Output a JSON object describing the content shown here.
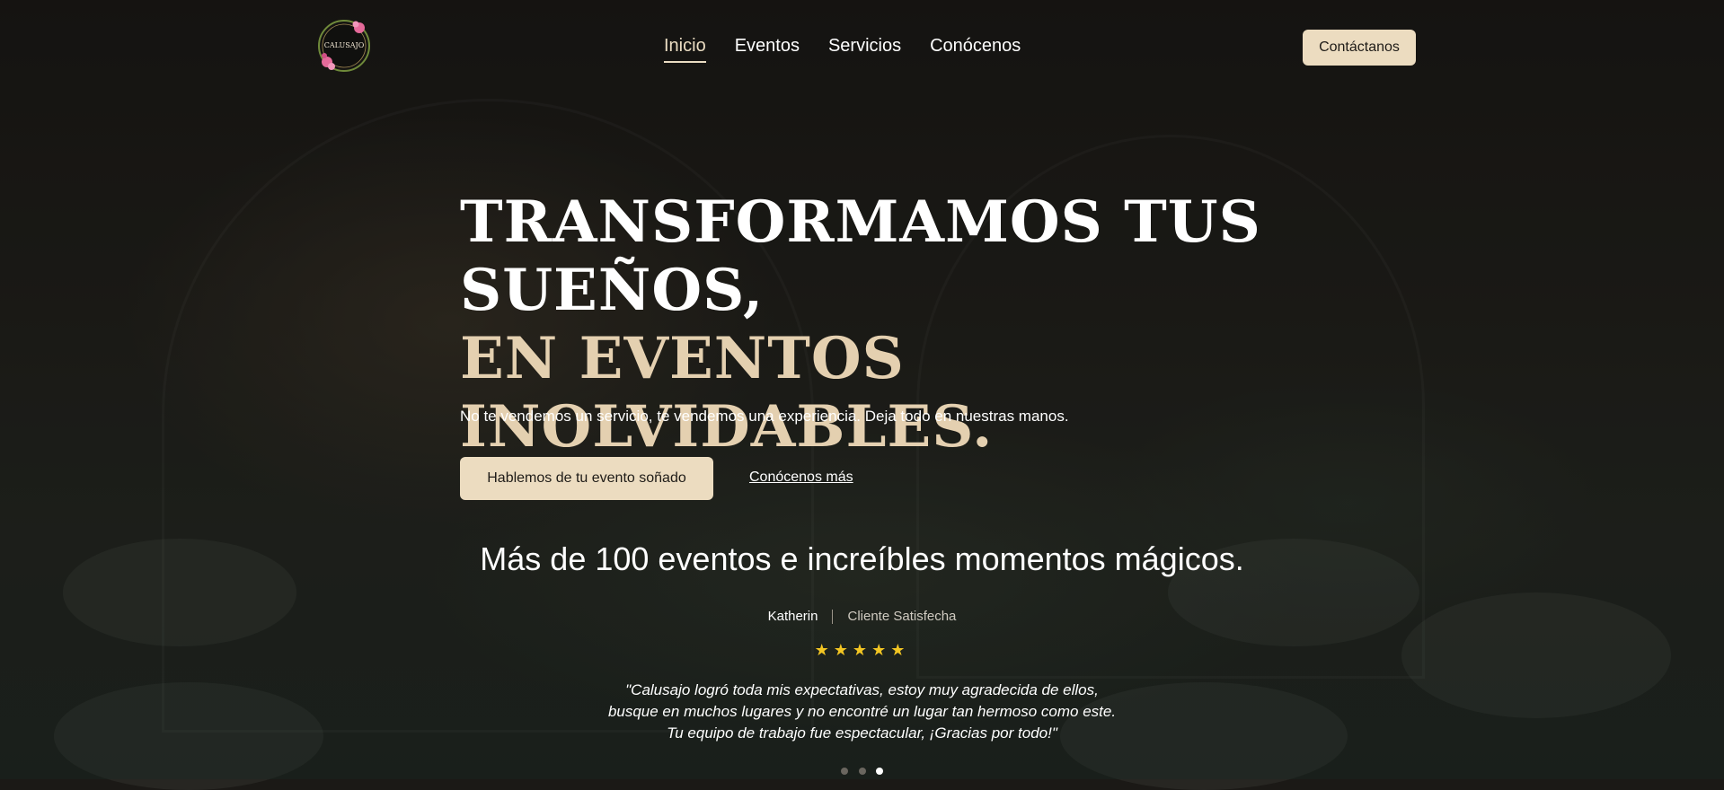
{
  "brand": {
    "logo_text": "CALUSAJO"
  },
  "nav": {
    "items": [
      {
        "label": "Inicio",
        "active": true
      },
      {
        "label": "Eventos",
        "active": false
      },
      {
        "label": "Servicios",
        "active": false
      },
      {
        "label": "Conócenos",
        "active": false
      }
    ]
  },
  "header": {
    "contact_label": "Contáctanos"
  },
  "hero": {
    "headline_line1": "TRANSFORMAMOS TUS",
    "headline_line2": "SUEÑOS,",
    "headline_line3": "EN EVENTOS INOLVIDABLES.",
    "subtitle": "No te vendemos un servicio, te vendemos una experiencia. Deja todo en nuestras manos.",
    "primary_cta": "Hablemos de tu evento soñado",
    "secondary_cta": "Conócenos más"
  },
  "testimonial": {
    "heading": "Más de 100 eventos e increíbles momentos mágicos.",
    "author": "Katherin",
    "role": "Cliente Satisfecha",
    "stars": "★★★★★",
    "rating": 5,
    "quote_lines": [
      "\"Calusajo logró toda mis expectativas, estoy muy agradecida de ellos,",
      "busque en muchos lugares y no encontré un lugar tan hermoso como este.",
      "Tu equipo de trabajo fue espectacular, ¡Gracias por todo!\""
    ],
    "slide_count": 3,
    "active_slide": 3
  },
  "colors": {
    "accent": "#ECDCC0",
    "gold_text": "#E4D0B0",
    "star": "#F3C623"
  }
}
